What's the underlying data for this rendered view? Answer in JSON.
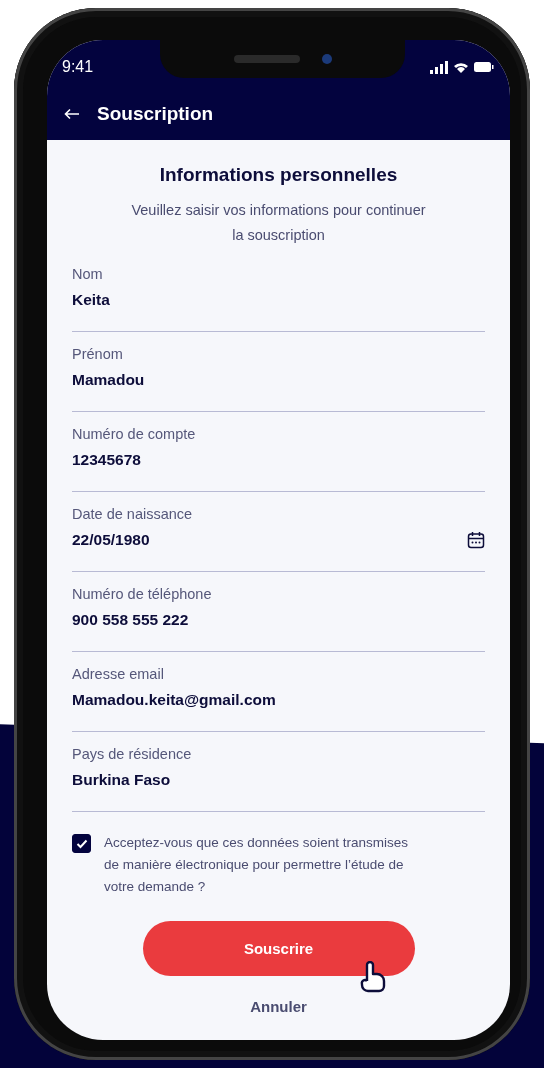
{
  "status_bar": {
    "time": "9:41"
  },
  "header": {
    "title": "Souscription"
  },
  "form": {
    "title": "Informations personnelles",
    "subtitle": "Veuillez saisir vos informations pour continuer la souscription",
    "fields": [
      {
        "kind": "text",
        "label": "Nom",
        "value": "Keita"
      },
      {
        "kind": "text",
        "label": "Prénom",
        "value": "Mamadou"
      },
      {
        "kind": "text",
        "label": "Numéro de compte",
        "value": "12345678"
      },
      {
        "kind": "date",
        "label": "Date de naissance",
        "value": "22/05/1980"
      },
      {
        "kind": "text",
        "label": "Numéro de téléphone",
        "value": "900 558 555 222"
      },
      {
        "kind": "text",
        "label": "Adresse email",
        "value": "Mamadou.keita@gmail.com"
      },
      {
        "kind": "text",
        "label": "Pays de résidence",
        "value": "Burkina Faso"
      }
    ],
    "consent": {
      "checked": true,
      "text": "Acceptez-vous que ces données soient transmises de manière électronique pour permettre l’étude de votre demande ?"
    },
    "submit": "Souscrire",
    "cancel": "Annuler"
  }
}
